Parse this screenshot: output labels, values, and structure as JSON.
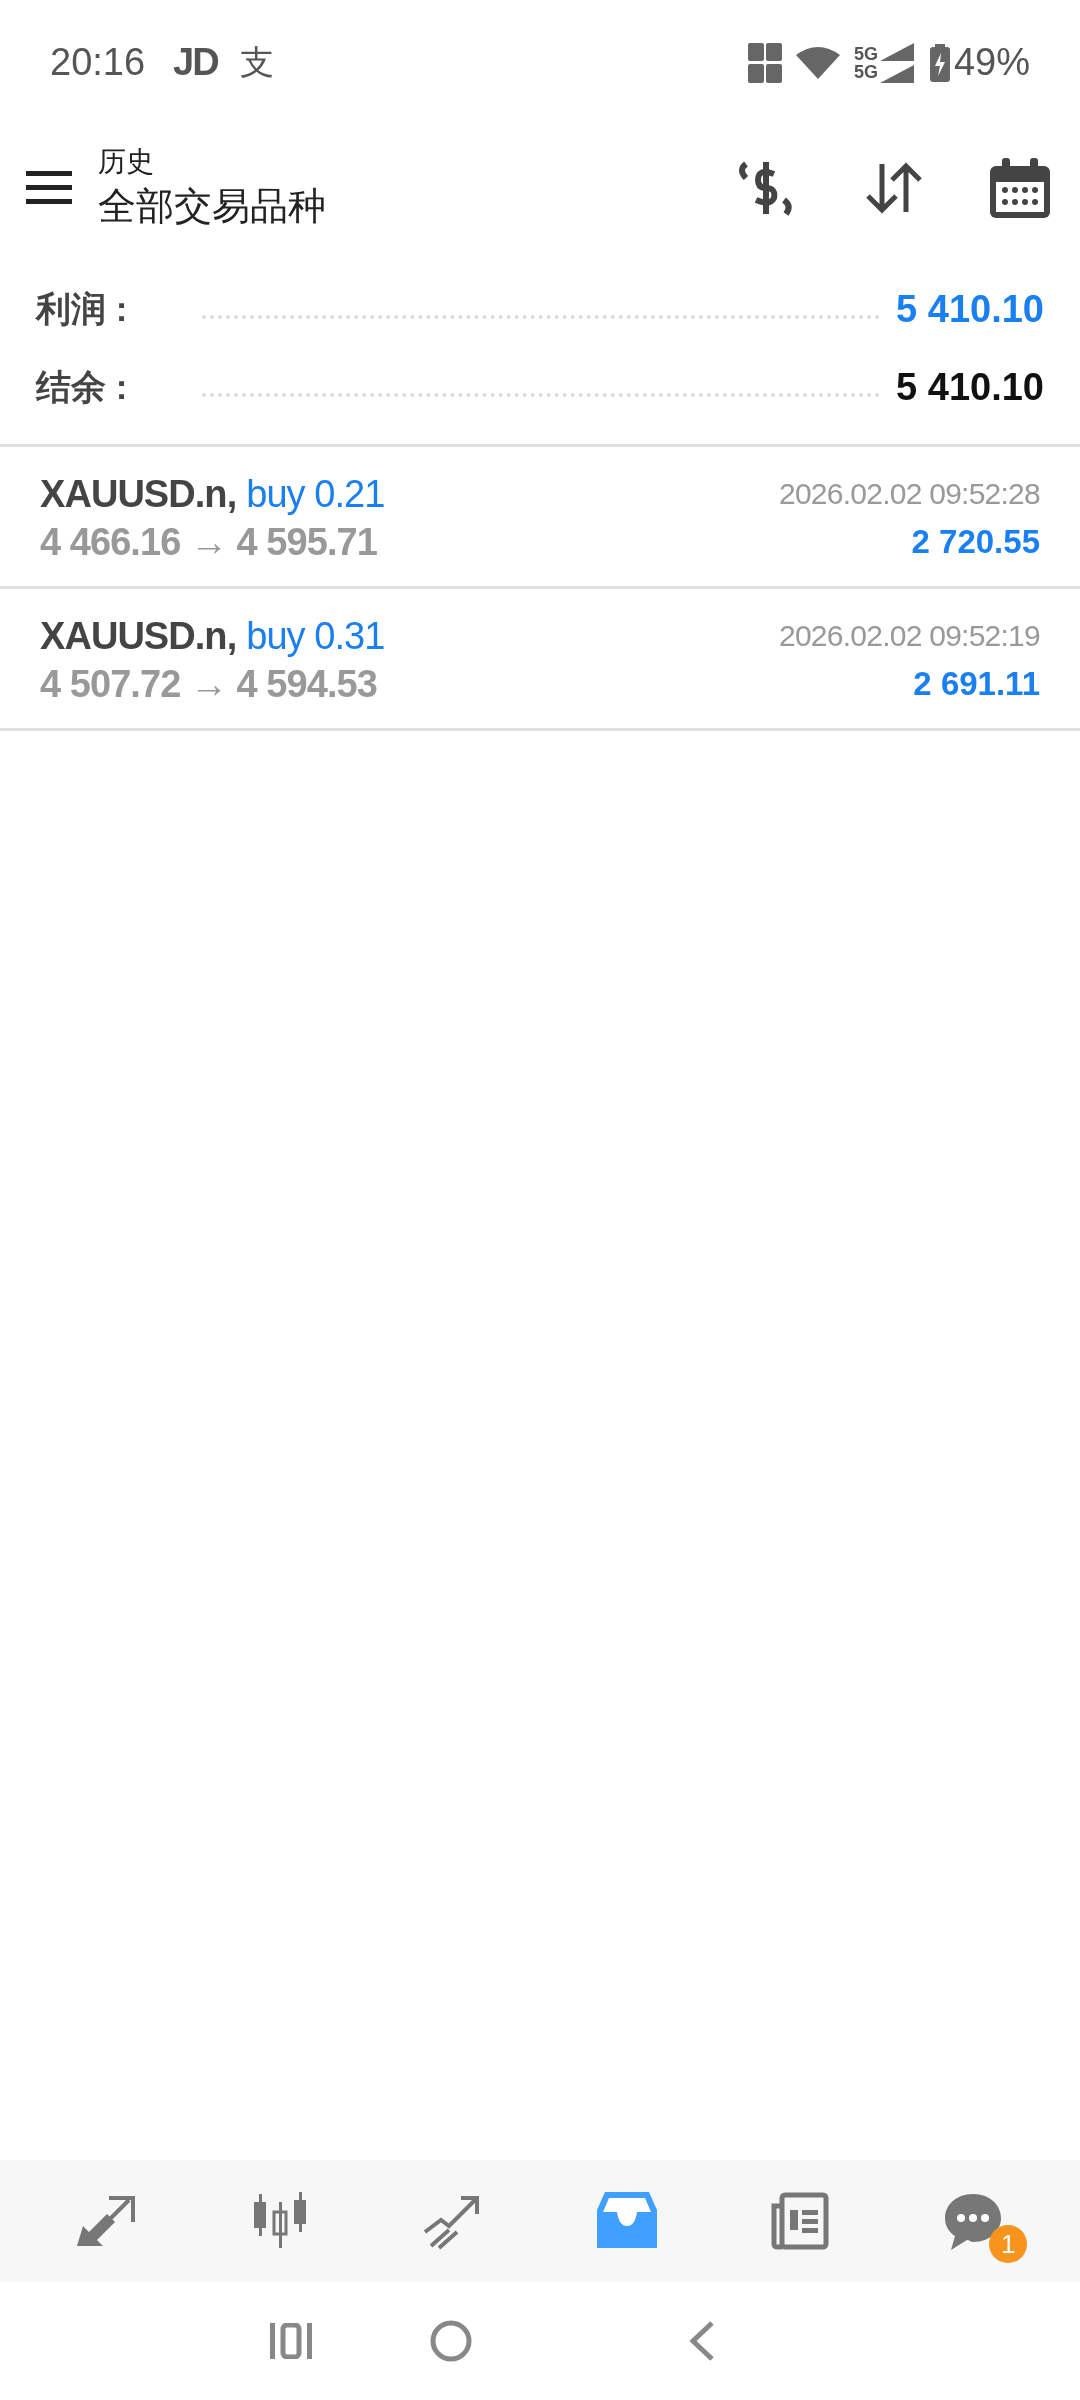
{
  "status_bar": {
    "time": "20:16",
    "notifications": [
      "JD",
      "支"
    ],
    "network_labels": [
      "5G",
      "5G"
    ],
    "battery": "49%"
  },
  "header": {
    "subtitle": "历史",
    "title": "全部交易品种"
  },
  "summary": [
    {
      "label": "利润 :",
      "value": "5 410.10",
      "highlight": true
    },
    {
      "label": "结余 :",
      "value": "5 410.10",
      "highlight": false
    }
  ],
  "trades": [
    {
      "symbol": "XAUUSD.n,",
      "side": "buy 0.21",
      "prices": "4 466.16 → 4 595.71",
      "time": "2026.02.02 09:52:28",
      "profit": "2 720.55"
    },
    {
      "symbol": "XAUUSD.n,",
      "side": "buy 0.31",
      "prices": "4 507.72 → 4 594.53",
      "time": "2026.02.02 09:52:19",
      "profit": "2 691.11"
    }
  ],
  "bottom_nav": [
    {
      "kind": "trade",
      "selected": false
    },
    {
      "kind": "quotes",
      "selected": false
    },
    {
      "kind": "chart",
      "selected": false
    },
    {
      "kind": "history",
      "selected": true
    },
    {
      "kind": "news",
      "selected": false
    },
    {
      "kind": "messages",
      "selected": false,
      "badge": "1"
    }
  ]
}
